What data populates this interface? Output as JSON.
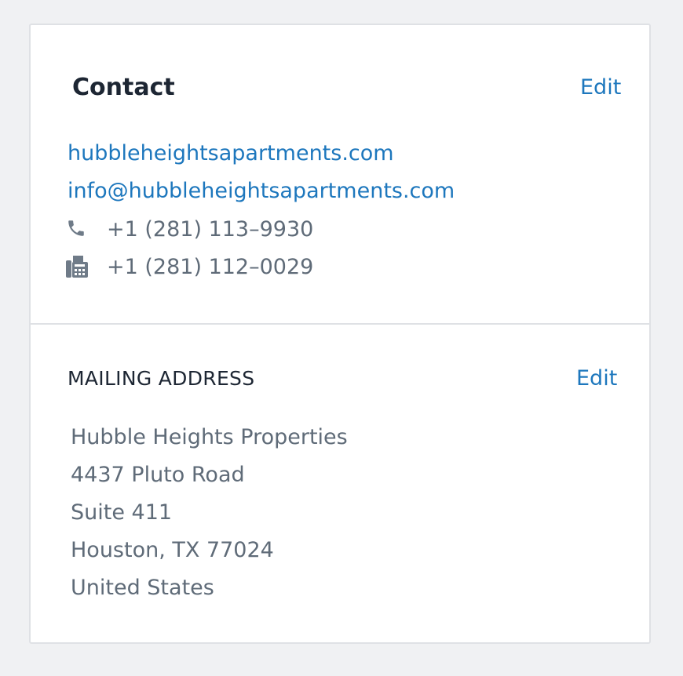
{
  "contact": {
    "title": "Contact",
    "edit_label": "Edit",
    "website": "hubbleheightsapartments.com",
    "email": "info@hubbleheightsapartments.com",
    "phone": "+1 (281) 113–9930",
    "fax": "+1 (281) 112–0029",
    "phone_icon": "phone-icon",
    "fax_icon": "fax-icon"
  },
  "mailing": {
    "heading": "MAILING ADDRESS",
    "edit_label": "Edit",
    "lines": [
      "Hubble Heights Properties",
      "4437 Pluto Road",
      "Suite 411",
      "Houston, TX 77024",
      "United States"
    ]
  },
  "colors": {
    "link": "#1d77bd",
    "heading": "#1d2633",
    "body_text": "#5f6b78",
    "border": "#dfe1e5",
    "background": "#f0f1f3"
  }
}
